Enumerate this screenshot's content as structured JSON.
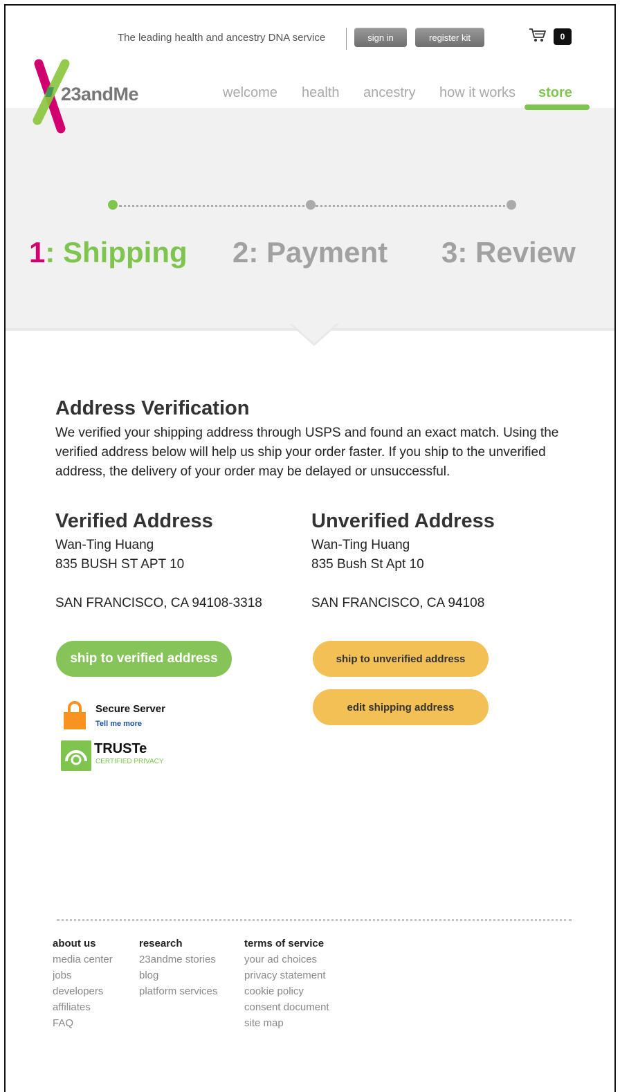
{
  "header": {
    "tagline": "The leading health and ancestry DNA service",
    "sign_in": "sign in",
    "register_kit": "register kit",
    "cart_count": "0",
    "logo_text": "23andMe",
    "nav": [
      "welcome",
      "health",
      "ancestry",
      "how it works",
      "store"
    ],
    "active_nav": "store"
  },
  "steps": {
    "step1_num": "1",
    "step1_label": ": Shipping",
    "step2": "2: Payment",
    "step3": "3: Review",
    "current_step": 1
  },
  "verification": {
    "title": "Address Verification",
    "intro": "We verified your shipping address through USPS and found an exact match. Using the verified address below will help us ship your order faster. If you ship to the unverified address, the delivery of your order may be delayed or unsuccessful."
  },
  "verified": {
    "title": "Verified Address",
    "name": "Wan-Ting Huang",
    "line1": "835 BUSH ST APT 10",
    "city": "SAN FRANCISCO, CA 94108-3318",
    "button": "ship to verified address"
  },
  "unverified": {
    "title": "Unverified Address",
    "name": "Wan-Ting Huang",
    "line1": "835 Bush St Apt 10",
    "city": "SAN FRANCISCO, CA 94108",
    "button": "ship to unverified address",
    "edit_button": "edit shipping address"
  },
  "badges": {
    "secure_title": "Secure Server",
    "secure_link": "Tell me more",
    "truste_name": "TRUSTe",
    "truste_sub": "CERTIFIED PRIVACY"
  },
  "footer": {
    "col1": {
      "head": "about us",
      "links": [
        "media center",
        "jobs",
        "developers",
        "affiliates",
        "FAQ"
      ]
    },
    "col2": {
      "head": "research",
      "links": [
        "23andme stories",
        "blog",
        "platform services"
      ]
    },
    "col3": {
      "head": "terms of service",
      "links": [
        "your ad choices",
        "privacy statement",
        "cookie policy",
        "consent document",
        "site map"
      ]
    }
  },
  "colors": {
    "brand_green": "#7ec44f",
    "brand_magenta": "#d1006f",
    "button_yellow": "#f2c055",
    "band_grey": "#f1f1f2"
  }
}
